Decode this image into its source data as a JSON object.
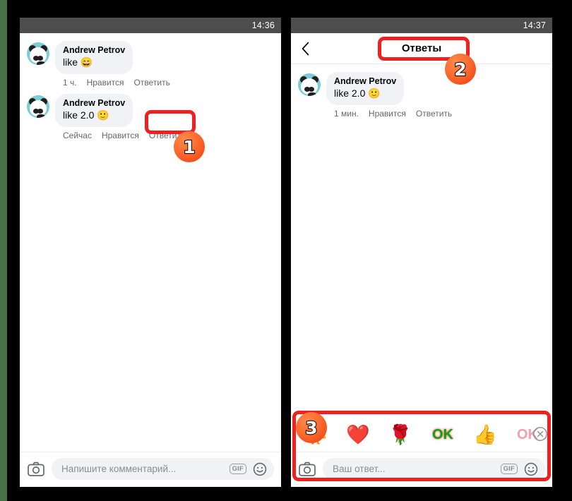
{
  "annotations": {
    "badges": [
      {
        "number": "1"
      },
      {
        "number": "2"
      },
      {
        "number": "3"
      }
    ],
    "highlight_color": "#ef2020",
    "badge_color": "#fb6b2e"
  },
  "left_phone": {
    "status_bar": {
      "time": "14:36"
    },
    "comments": [
      {
        "author": "Andrew Petrov",
        "text": "like",
        "emoji": "😄",
        "time": "1 ч.",
        "like_label": "Нравится",
        "reply_label": "Ответить"
      },
      {
        "author": "Andrew Petrov",
        "text": "like 2.0",
        "emoji": "🙂",
        "time": "Сейчас",
        "like_label": "Нравится",
        "reply_label": "Ответить"
      }
    ],
    "composer": {
      "camera_icon": "camera-icon",
      "placeholder": "Напишите комментарий...",
      "gif_label": "GIF",
      "emoji_icon": "smiley-icon"
    }
  },
  "right_phone": {
    "status_bar": {
      "time": "14:37"
    },
    "header": {
      "back_icon": "chevron-left-icon",
      "title": "Ответы"
    },
    "comments": [
      {
        "author": "Andrew Petrov",
        "text": "like 2.0",
        "emoji": "🙂",
        "time": "1 мин.",
        "like_label": "Нравится",
        "reply_label": "Ответить"
      }
    ],
    "sticker_tray": {
      "stickers": [
        {
          "name": "yellow-duck-sticker",
          "glyph": "🐥"
        },
        {
          "name": "red-heart-sticker",
          "glyph": "❤️"
        },
        {
          "name": "hand-with-rose-sticker",
          "glyph": "🌹"
        },
        {
          "name": "ok-green-sticker",
          "glyph": "OK"
        },
        {
          "name": "thumbs-up-sticker",
          "glyph": "👍"
        },
        {
          "name": "ok-pink-sticker",
          "glyph": "OK"
        }
      ],
      "close_icon": "close-circle-icon"
    },
    "composer": {
      "camera_icon": "camera-icon",
      "placeholder": "Ваш ответ...",
      "gif_label": "GIF",
      "emoji_icon": "smiley-icon"
    }
  }
}
